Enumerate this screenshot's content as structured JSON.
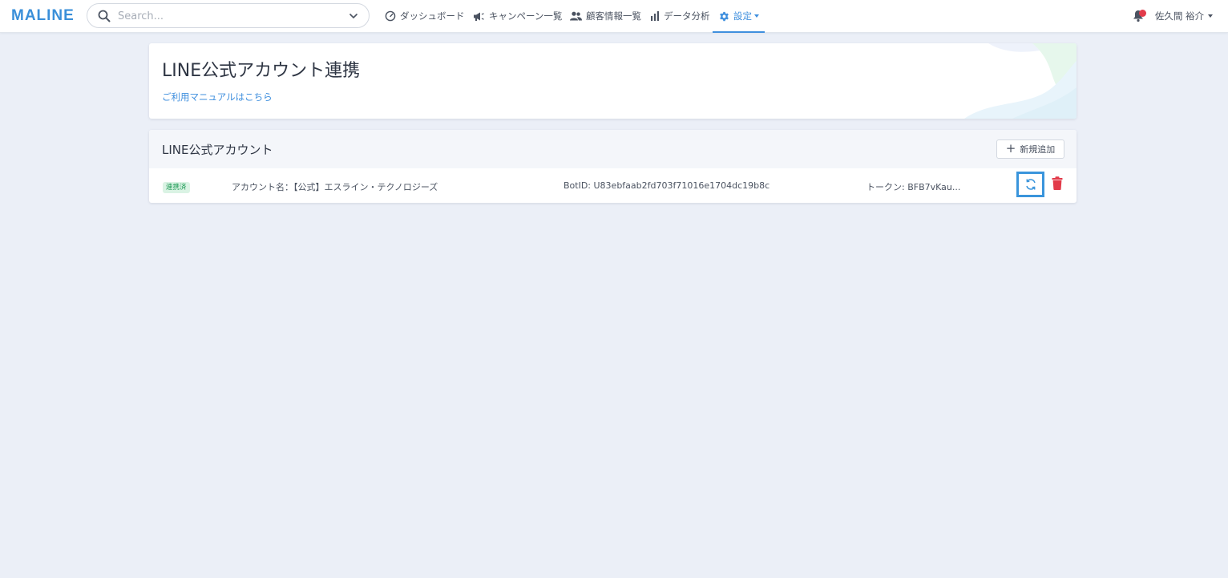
{
  "brand": {
    "logo": "MALINE"
  },
  "search": {
    "placeholder": "Search..."
  },
  "nav": {
    "items": [
      {
        "label": "ダッシュボード",
        "icon": "gauge-icon"
      },
      {
        "label": "キャンペーン一覧",
        "icon": "megaphone-icon"
      },
      {
        "label": "顧客情報一覧",
        "icon": "users-icon"
      },
      {
        "label": "データ分析",
        "icon": "bar-chart-icon"
      },
      {
        "label": "設定",
        "icon": "gear-icon",
        "active": true
      }
    ]
  },
  "user": {
    "name": "佐久間 裕介",
    "notification_icon": "bell-icon"
  },
  "page": {
    "title": "LINE公式アカウント連携",
    "manual_link": "ご利用マニュアルはこちら"
  },
  "accounts": {
    "title": "LINE公式アカウント",
    "add_button": "新規追加",
    "rows": [
      {
        "status": "連携済",
        "account_name": "アカウント名：【公式】エスライン・テクノロジーズ",
        "bot_id": "BotID: U83ebfaab2fd703f71016e1704dc19b8c",
        "token": "トークン: BFB7vKau..."
      }
    ]
  },
  "colors": {
    "accent": "#3f8fde",
    "background": "#ebeff7",
    "status_green": "#1d9a55",
    "danger": "#e23b4a"
  }
}
